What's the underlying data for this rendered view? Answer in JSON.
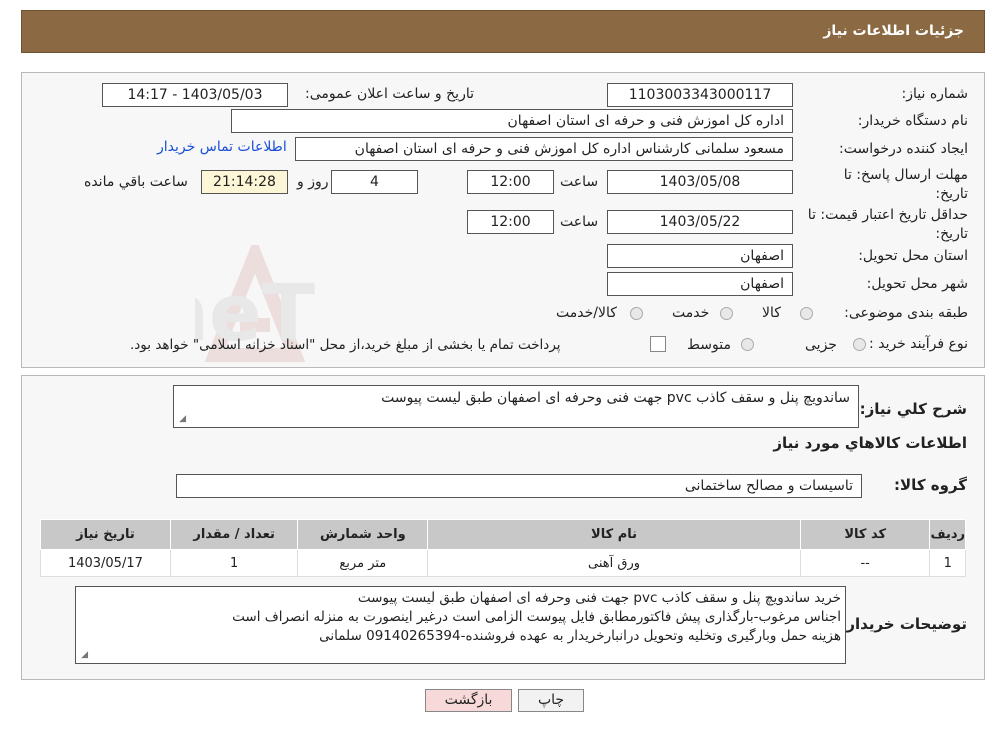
{
  "header": {
    "title": "جزئیات اطلاعات نیاز"
  },
  "form": {
    "need_number_label": "شماره نیاز:",
    "need_number": "1103003343000117",
    "announce_label": "تاریخ و ساعت اعلان عمومی:",
    "announce_value": "1403/05/03 - 14:17",
    "buyer_org_label": "نام دستگاه خریدار:",
    "buyer_org": "اداره کل اموزش فنی و حرفه ای استان اصفهان",
    "creator_label": "ایجاد کننده درخواست:",
    "creator": "مسعود سلمانی کارشناس اداره کل اموزش فنی و حرفه ای استان اصفهان",
    "contact_link": "اطلاعات تماس خریدار",
    "deadline_label": "مهلت ارسال پاسخ: تا تاریخ:",
    "deadline_date": "1403/05/08",
    "time_label": "ساعت",
    "deadline_time": "12:00",
    "days_value": "4",
    "days_label": "روز و",
    "remaining_time": "21:14:28",
    "remaining_label": "ساعت باقي مانده",
    "validity_label": "حداقل تاریخ اعتبار قیمت: تا تاریخ:",
    "validity_date": "1403/05/22",
    "validity_time": "12:00",
    "province_label": "استان محل تحویل:",
    "province": "اصفهان",
    "city_label": "شهر محل تحویل:",
    "city": "اصفهان",
    "category_label": "طبقه بندی موضوعی:",
    "category_options": [
      "کالا",
      "خدمت",
      "کالا/خدمت"
    ],
    "process_label": "نوع فرآیند خرید :",
    "process_options": [
      "جزیی",
      "متوسط"
    ],
    "process_note": "پرداخت تمام یا بخشی از مبلغ خرید،از محل \"اسناد خزانه اسلامی\" خواهد بود."
  },
  "summary": {
    "label": "شرح کلي نياز:",
    "value": "ساندویچ پنل و سقف کاذب pvc  جهت فنی وحرفه ای اصفهان طبق لیست پیوست"
  },
  "goods": {
    "section_title": "اطلاعات کالاهاي مورد نياز",
    "group_label": "گروه کالا:",
    "group_value": "تاسیسات و مصالح ساختمانی",
    "columns": [
      "رديف",
      "کد کالا",
      "نام کالا",
      "واحد شمارش",
      "تعداد / مقدار",
      "تاريخ نياز"
    ],
    "rows": [
      [
        "1",
        "--",
        "ورق آهنی",
        "متر مربع",
        "1",
        "1403/05/17"
      ]
    ]
  },
  "buyer_notes": {
    "label": "توضيحات خريدار:",
    "lines": [
      "خرید ساندویچ پنل و سقف کاذب pvc  جهت فنی وحرفه ای اصفهان طبق لیست پیوست",
      "اجناس مرغوب-بارگذاری پیش فاکتورمطابق فایل پیوست الزامی است درغیر اینصورت به منزله انصراف است",
      "هزینه حمل وبارگیری وتخلیه وتحویل درانبارخریدار به عهده فروشنده-09140265394 سلمانی"
    ]
  },
  "buttons": {
    "print": "چاپ",
    "back": "بازگشت"
  },
  "watermark": {
    "text": "AriaTender.neT"
  },
  "colors": {
    "header_bg": "#8b6a43",
    "back_button_bg": "#f7d9d9",
    "link": "#1a4fd6"
  }
}
